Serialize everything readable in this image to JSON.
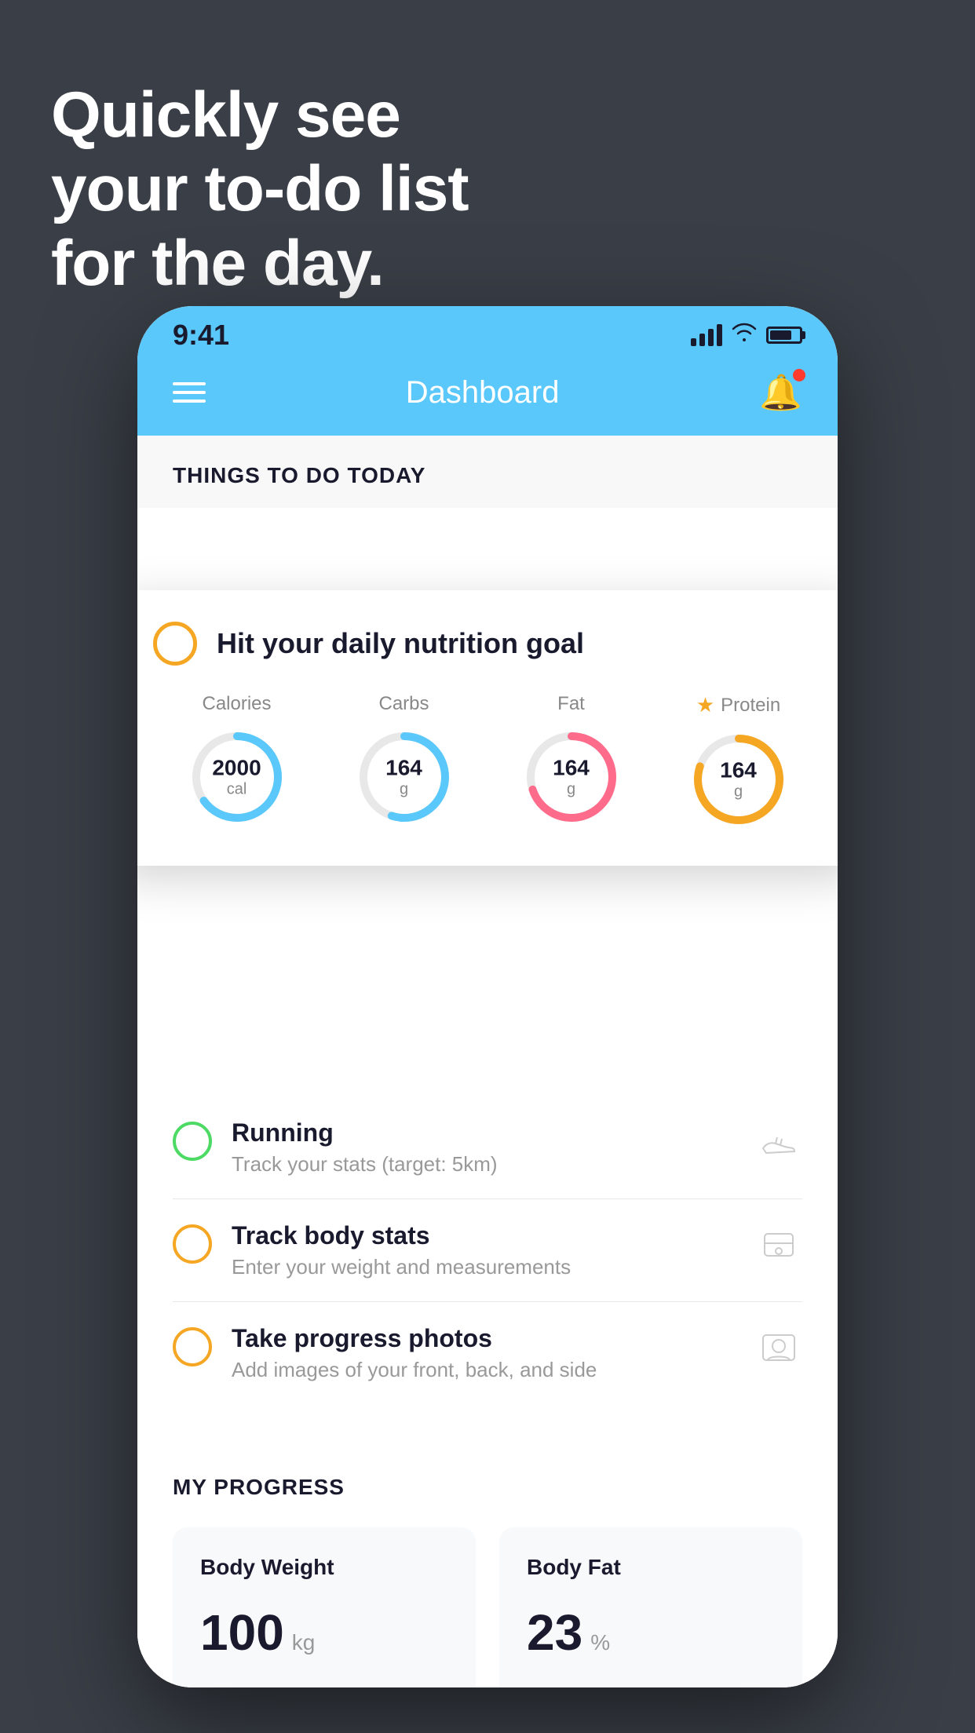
{
  "background": {
    "color": "#3a3f47"
  },
  "headline": {
    "line1": "Quickly see",
    "line2": "your to-do list",
    "line3": "for the day."
  },
  "phone": {
    "statusBar": {
      "time": "9:41"
    },
    "header": {
      "title": "Dashboard",
      "menuIcon": "hamburger-icon",
      "bellIcon": "bell-icon"
    },
    "thingsToDo": {
      "sectionTitle": "THINGS TO DO TODAY",
      "nutritionCard": {
        "title": "Hit your daily nutrition goal",
        "nutrients": [
          {
            "label": "Calories",
            "value": "2000",
            "unit": "cal",
            "color": "#5ac8fa",
            "percentage": 65
          },
          {
            "label": "Carbs",
            "value": "164",
            "unit": "g",
            "color": "#5ac8fa",
            "percentage": 55
          },
          {
            "label": "Fat",
            "value": "164",
            "unit": "g",
            "color": "#ff6b8a",
            "percentage": 70
          },
          {
            "label": "Protein",
            "value": "164",
            "unit": "g",
            "color": "#f5a623",
            "percentage": 80,
            "starred": true
          }
        ]
      },
      "items": [
        {
          "id": "running",
          "title": "Running",
          "subtitle": "Track your stats (target: 5km)",
          "circleColor": "green",
          "icon": "shoe-icon"
        },
        {
          "id": "body-stats",
          "title": "Track body stats",
          "subtitle": "Enter your weight and measurements",
          "circleColor": "yellow",
          "icon": "scale-icon"
        },
        {
          "id": "progress-photos",
          "title": "Take progress photos",
          "subtitle": "Add images of your front, back, and side",
          "circleColor": "yellow",
          "icon": "photo-icon"
        }
      ]
    },
    "myProgress": {
      "sectionTitle": "MY PROGRESS",
      "cards": [
        {
          "id": "body-weight",
          "title": "Body Weight",
          "value": "100",
          "unit": "kg"
        },
        {
          "id": "body-fat",
          "title": "Body Fat",
          "value": "23",
          "unit": "%"
        }
      ]
    }
  }
}
